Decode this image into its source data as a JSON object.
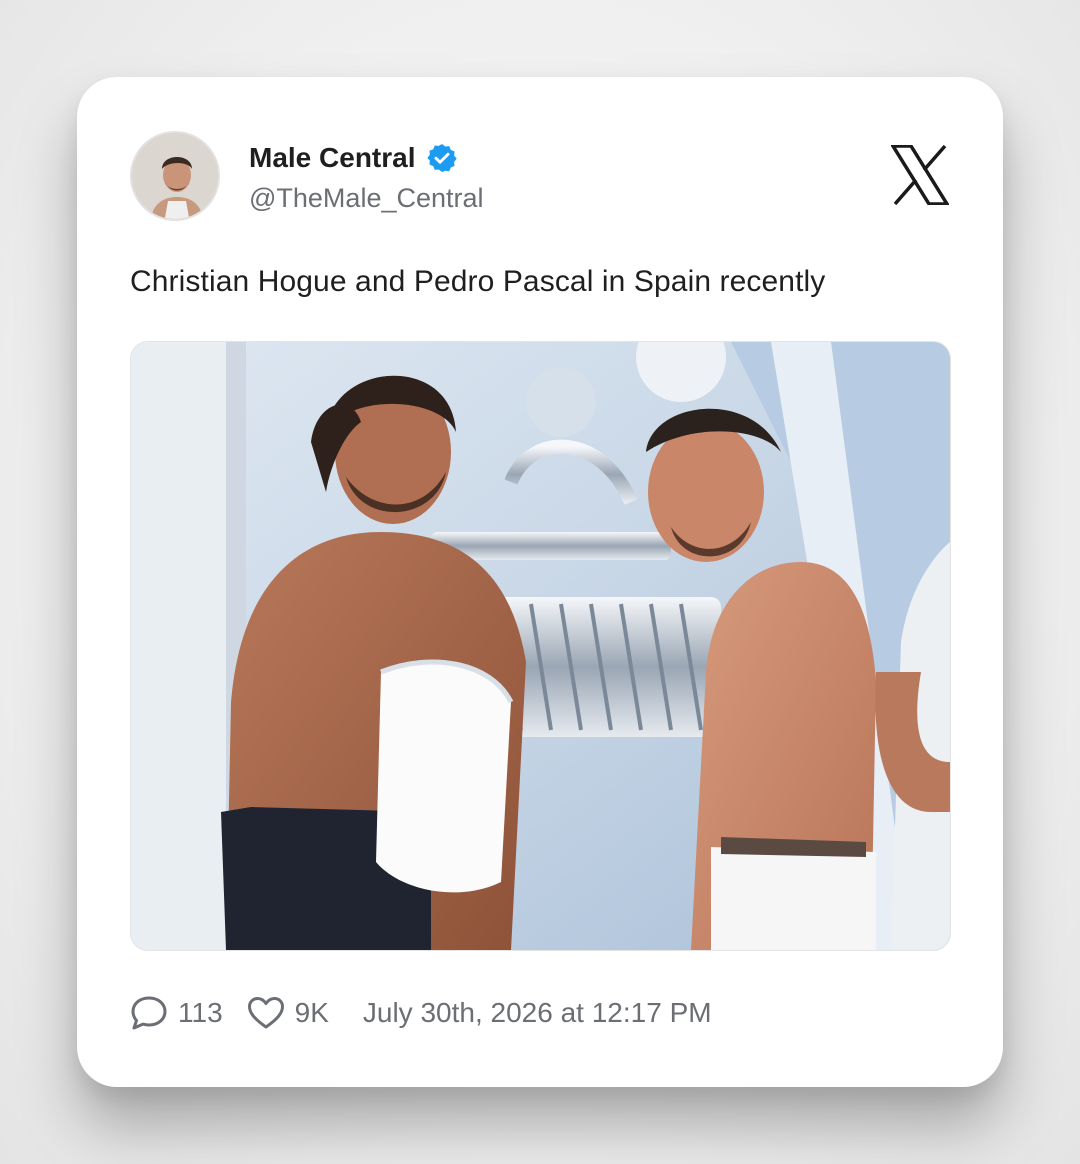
{
  "post": {
    "display_name": "Male Central",
    "handle": "@TheMale_Central",
    "verified": true,
    "text": "Christian Hogue and Pedro Pascal in Spain recently",
    "platform_icon": "x-logo-icon",
    "media_description": "photo"
  },
  "footer": {
    "replies": "113",
    "likes": "9K",
    "timestamp": "July 30th, 2026 at 12:17 PM"
  },
  "colors": {
    "verified": "#1d9bf0",
    "text_primary": "#1f1f1f",
    "text_secondary": "#6b6f74",
    "card_background": "#ffffff"
  }
}
